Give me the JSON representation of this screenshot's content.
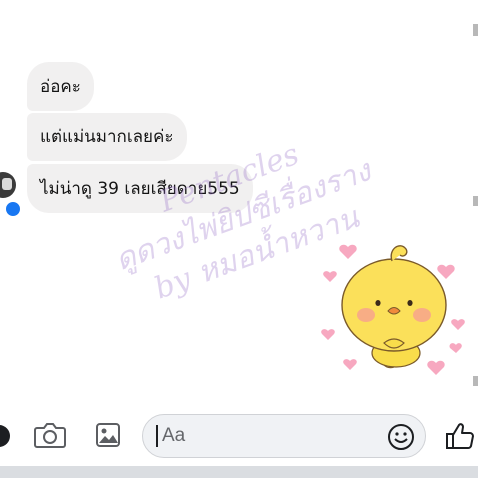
{
  "messages": [
    {
      "text": "อ่อคะ"
    },
    {
      "text": "แต่แม่นมากเลยค่ะ"
    },
    {
      "text": "ไม่น่าดู 39 เลยเสียดาย555"
    }
  ],
  "watermark": {
    "lines": [
      "Pentacles",
      "ดูดวงไพ่ยิปซีเรื่องราง",
      "by หมอน้ำหวาน"
    ]
  },
  "composer": {
    "placeholder": "Aa"
  },
  "icons": {
    "add": "plus-circle-icon",
    "camera": "camera-icon",
    "gallery": "image-icon",
    "emoji": "smiley-icon",
    "like": "thumbs-up-icon",
    "sticker": "yellow-chick-sticker"
  },
  "colors": {
    "bubble": "#f1f0f0",
    "messenger_blue": "#1877f2",
    "icon": "#1c1e21",
    "watermark": "#b08ad6"
  }
}
